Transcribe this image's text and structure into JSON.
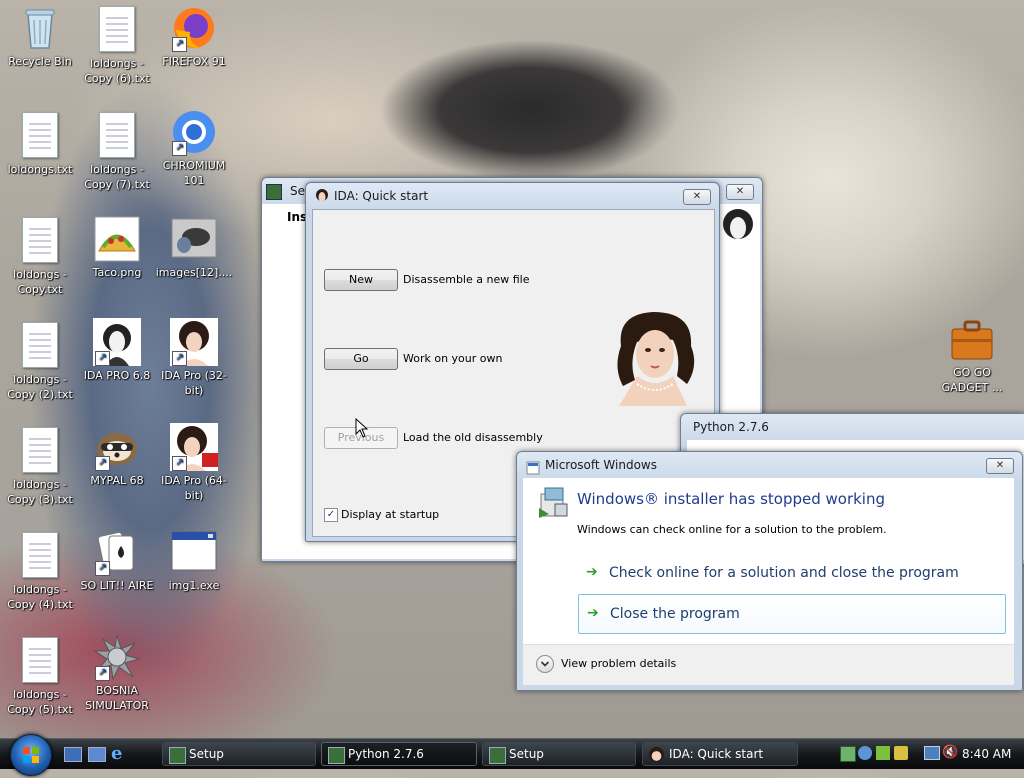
{
  "desktop": {
    "icons": [
      {
        "label": "Recycle Bin"
      },
      {
        "label": "loldongs - Copy (6).txt"
      },
      {
        "label": "FIREFOX 91"
      },
      {
        "label": "loldongs.txt"
      },
      {
        "label": "loldongs - Copy (7).txt"
      },
      {
        "label": "CHROMIUM 101"
      },
      {
        "label": "loldongs - Copy.txt"
      },
      {
        "label": "Taco.png"
      },
      {
        "label": "images[12]...."
      },
      {
        "label": "loldongs - Copy (2).txt"
      },
      {
        "label": "IDA PRO 6.8"
      },
      {
        "label": "IDA Pro (32-bit)"
      },
      {
        "label": "loldongs - Copy (3).txt"
      },
      {
        "label": "MYPAL 68"
      },
      {
        "label": "IDA Pro (64-bit)"
      },
      {
        "label": "loldongs - Copy (4).txt"
      },
      {
        "label": "SO LIT!! AIRE"
      },
      {
        "label": "img1.exe"
      },
      {
        "label": "loldongs - Copy (5).txt"
      },
      {
        "label": "BOSNIA SIMULATOR"
      },
      {
        "label": "GO GO GADGET ..."
      }
    ]
  },
  "setup_window": {
    "title": "Setu",
    "heading": "Ins",
    "close": "✕"
  },
  "ida_window": {
    "title": "IDA: Quick start",
    "close": "✕",
    "new_button": "New",
    "new_desc": "Disassemble a new file",
    "go_button": "Go",
    "go_desc": "Work on your own",
    "previous_button": "Previous",
    "previous_desc": "Load the old disassembly",
    "startup_checkbox": "Display at startup",
    "startup_checked": "✓"
  },
  "python_window": {
    "title": "Python 2.7.6"
  },
  "error_dialog": {
    "title": "Microsoft Windows",
    "close": "✕",
    "heading": "Windows® installer has stopped working",
    "message": "Windows can check online for a solution to the problem.",
    "option1": "Check online for a solution and close the program",
    "option2": "Close the program",
    "details": "View problem details",
    "arrow": "➔"
  },
  "taskbar": {
    "buttons": [
      {
        "label": "Setup"
      },
      {
        "label": "Python 2.7.6"
      },
      {
        "label": "Setup"
      },
      {
        "label": "IDA: Quick start"
      }
    ],
    "clock": "8:40 AM"
  },
  "colors": {
    "link_blue": "#1e5a96",
    "arrow_green": "#2e9e2e"
  }
}
